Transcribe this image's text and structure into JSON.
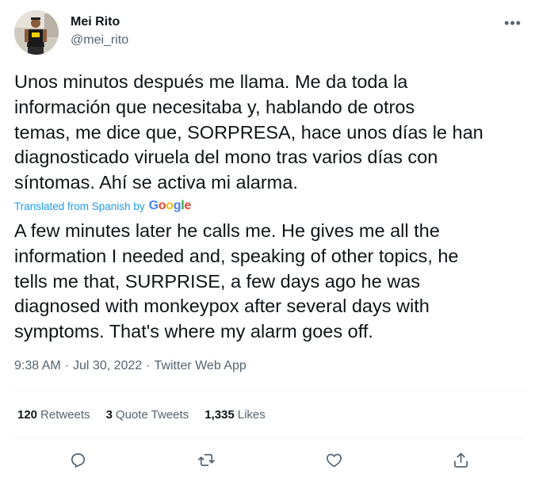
{
  "author": {
    "display_name": "Mei Rito",
    "handle": "@mei_rito"
  },
  "tweet": {
    "original_text": "Unos minutos después me llama. Me da toda la\ninformación que necesitaba y, hablando de otros\ntemas, me dice que, SORPRESA, hace unos días le han\ndiagnosticado viruela del mono tras varios días con\nsíntomas. Ahí se activa mi alarma.",
    "translated_by_label": "Translated from Spanish by",
    "translation_provider_logo": "Google",
    "translated_text": "A few minutes later he calls me. He gives me all the\ninformation I needed and, speaking of other topics, he\ntells me that, SURPRISE, a few days ago he was\ndiagnosed with monkeypox after several days with\nsymptoms. That's where my alarm goes off.",
    "time": "9:38 AM",
    "separator": "·",
    "date": "Jul 30, 2022",
    "source": "Twitter Web App"
  },
  "stats": {
    "retweets_count": "120",
    "retweets_label": "Retweets",
    "quotes_count": "3",
    "quotes_label": "Quote Tweets",
    "likes_count": "1,335",
    "likes_label": "Likes"
  },
  "icons": {
    "more": "more-icon",
    "reply": "reply-icon",
    "retweet": "retweet-icon",
    "like": "heart-icon",
    "share": "share-icon"
  },
  "colors": {
    "text_primary": "#0f1419",
    "text_secondary": "#536471",
    "link_blue": "#1d9bf0",
    "divider": "#eff3f4"
  }
}
